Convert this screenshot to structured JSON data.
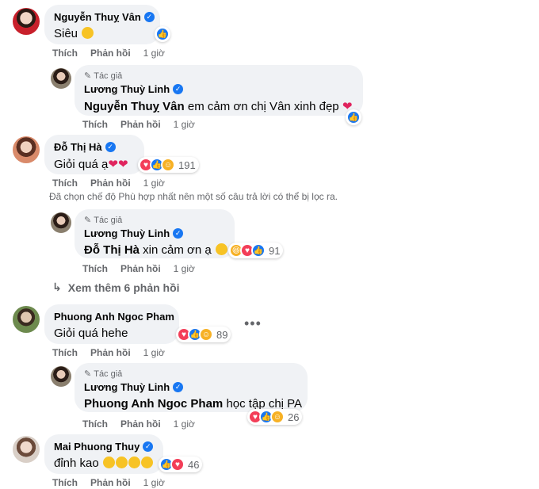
{
  "labels": {
    "like": "Thích",
    "reply": "Phản hồi",
    "author": "Tác giả"
  },
  "comments": [
    {
      "name": "Nguyễn Thuỵ Vân",
      "text": "Siêu",
      "time": "1 giờ",
      "reactions": [
        "like"
      ],
      "count": "",
      "reply": {
        "name": "Lương Thuỳ Linh",
        "tag": "Nguyễn Thuỵ Vân",
        "text": "em cảm ơn chị Vân xinh đẹp",
        "time": "1 giờ",
        "reactions": [
          "like"
        ],
        "count": ""
      }
    },
    {
      "name": "Đỗ Thị Hà",
      "text": "Giỏi quá ạ",
      "time": "1 giờ",
      "reactions": [
        "love",
        "like",
        "care"
      ],
      "count": "191",
      "reply": {
        "name": "Lương Thuỳ Linh",
        "tag": "Đỗ Thị Hà",
        "text": "xin cảm ơn ạ",
        "time": "1 giờ",
        "reactions": [
          "haha",
          "love",
          "like"
        ],
        "count": "91"
      }
    },
    {
      "name": "Phuong Anh Ngoc Pham",
      "text": "Giỏi quá hehe",
      "time": "1 giờ",
      "reactions": [
        "love",
        "like",
        "care"
      ],
      "count": "89",
      "reply": {
        "name": "Lương Thuỳ Linh",
        "tag": "Phuong Anh Ngoc Pham",
        "text": "học tập chị PA",
        "time": "1 giờ",
        "reactions": [
          "love",
          "like",
          "care"
        ],
        "count": "26"
      }
    },
    {
      "name": "Mai Phuong Thuy",
      "text": "đỉnh kao",
      "time": "1 giờ",
      "reactions": [
        "like",
        "love"
      ],
      "count": "46"
    }
  ],
  "notice": "Đã chọn chế độ Phù hợp nhất nên một số câu trả lời có thể bị lọc ra.",
  "see_more": "Xem thêm 6 phản hồi",
  "icons": {
    "verified": "verified-badge-icon",
    "pen": "pencil-icon",
    "reply_arrow": "reply-arrow-icon",
    "more": "more-options-icon"
  },
  "colors": {
    "like": "#1877f2",
    "love": "#f33e58",
    "care": "#f7b125",
    "bubble": "#f0f2f5",
    "muted": "#65676b"
  }
}
